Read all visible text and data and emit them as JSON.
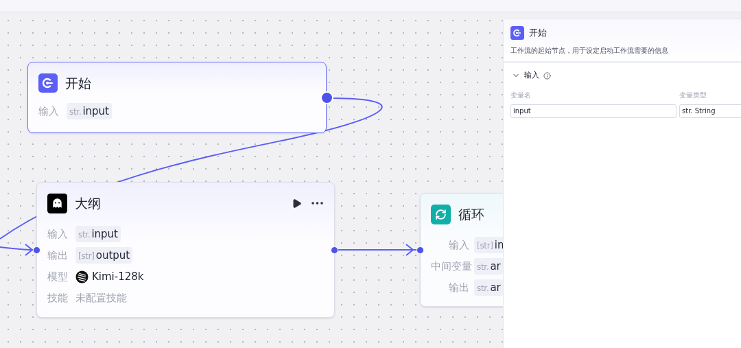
{
  "nodes": [
    {
      "kind": "start",
      "title": "开始",
      "selected": true,
      "rows": [
        {
          "kind": "var",
          "label": "输入",
          "tag": "str.",
          "value": "input"
        }
      ]
    },
    {
      "kind": "llm",
      "title": "大纲",
      "selected": false,
      "rows": [
        {
          "kind": "var",
          "label": "输入",
          "tag": "str.",
          "value": "input"
        },
        {
          "kind": "var",
          "label": "输出",
          "tag": "[str]",
          "value": "output"
        },
        {
          "kind": "model",
          "label": "模型",
          "value": "Kimi-128k"
        },
        {
          "kind": "empty",
          "label": "技能",
          "value": "未配置技能"
        }
      ]
    },
    {
      "kind": "loop",
      "title": "循环",
      "selected": false,
      "rows": [
        {
          "kind": "var",
          "label": "输入",
          "tag": "[str]",
          "value": "in"
        },
        {
          "kind": "var",
          "label": "中间变量",
          "tag": "str.",
          "value": "ar"
        },
        {
          "kind": "var",
          "label": "输出",
          "tag": "str.",
          "value": "ar"
        }
      ]
    }
  ],
  "panel": {
    "title": "开始",
    "description": "工作流的起始节点，用于设定启动工作流需要的信息",
    "section": {
      "title": "输入",
      "expanded": true,
      "columns": [
        "变量名",
        "变量类型"
      ],
      "fields": [
        {
          "value": "input"
        },
        {
          "value": "str. String"
        }
      ]
    }
  }
}
